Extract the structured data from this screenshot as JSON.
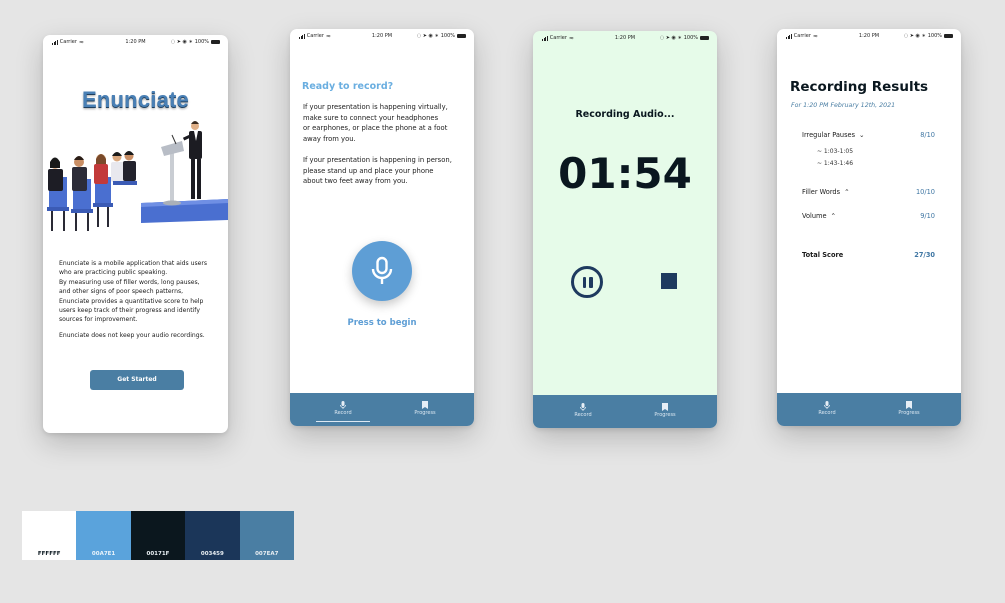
{
  "status_bar": {
    "carrier": "Carrier",
    "time": "1:20 PM",
    "battery": "100%"
  },
  "nav": {
    "record": "Record",
    "progress": "Progress"
  },
  "screen1": {
    "logo": "Enunciate",
    "desc_lines": [
      "Enunciate is a mobile application that aids users",
      "who are practicing public speaking.",
      "By measuring use of filler words, long pauses,",
      "and other signs of poor speech patterns,",
      "Enunciate provides a quantitative score to help",
      "users keep track of their progress and identify",
      "sources for improvement."
    ],
    "note": "Enunciate does not keep your audio recordings.",
    "button": "Get Started"
  },
  "screen2": {
    "title": "Ready to record?",
    "para1": [
      "If your presentation is happening virtually,",
      "make sure to connect your headphones",
      "or earphones, or place the phone at a foot",
      "away from you."
    ],
    "para2": [
      "If your presentation is happening in person,",
      "please stand up and place your phone",
      "about two feet away from you."
    ],
    "press": "Press to begin"
  },
  "screen3": {
    "title": "Recording Audio...",
    "timer": "01:54"
  },
  "screen4": {
    "title": "Recording Results",
    "subtitle": "For 1:20 PM February 12th, 2021",
    "rows": [
      {
        "label": "Irregular Pauses",
        "score": "8/10"
      },
      {
        "label": "Filler Words",
        "score": "10/10"
      },
      {
        "label": "Volume",
        "score": "9/10"
      }
    ],
    "pause_items": [
      "~ 1:03-1:05",
      "~ 1:43-1:46"
    ],
    "total_label": "Total Score",
    "total_score": "27/30"
  },
  "palette": [
    {
      "hex": "FFFFFF",
      "color": "#ffffff",
      "text": "#0a171f"
    },
    {
      "hex": "00A7E1",
      "color": "#5aa3dc",
      "text": "#e8f3fb"
    },
    {
      "hex": "00171F",
      "color": "#0b171e",
      "text": "#e8eef2"
    },
    {
      "hex": "003459",
      "color": "#1b3659",
      "text": "#e8eef2"
    },
    {
      "hex": "007EA7",
      "color": "#4a7ea3",
      "text": "#e8eef2"
    }
  ]
}
